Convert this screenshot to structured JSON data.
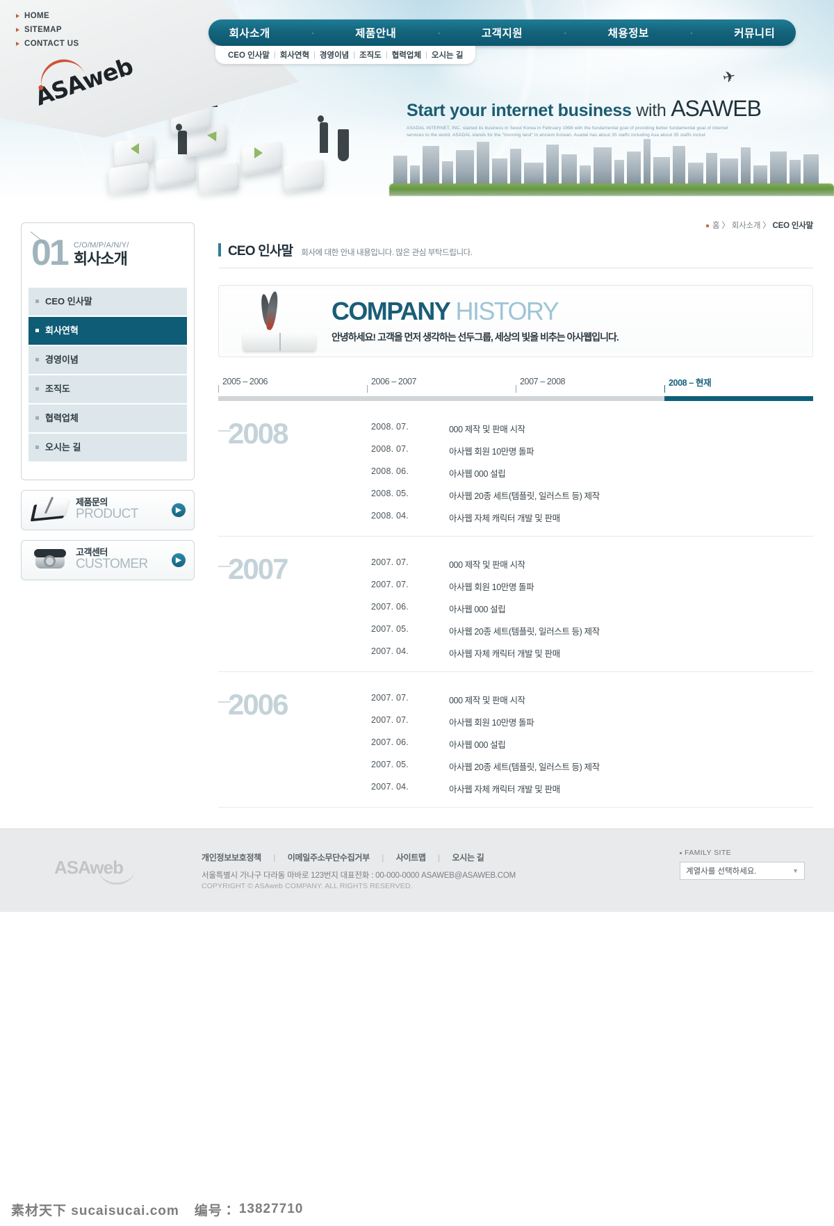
{
  "utility_nav": [
    {
      "label": "HOME"
    },
    {
      "label": "SITEMAP"
    },
    {
      "label": "CONTACT US"
    }
  ],
  "logo": {
    "text": "ASAweb"
  },
  "gnb": {
    "separator": "·",
    "items": [
      {
        "label": "회사소개"
      },
      {
        "label": "제품안내"
      },
      {
        "label": "고객지원"
      },
      {
        "label": "채용정보"
      },
      {
        "label": "커뮤니티"
      }
    ]
  },
  "snb": {
    "separator": "|",
    "items": [
      {
        "label": "CEO 인사말"
      },
      {
        "label": "회사연혁"
      },
      {
        "label": "경영이념"
      },
      {
        "label": "조직도"
      },
      {
        "label": "협력업체"
      },
      {
        "label": "오시는 길"
      }
    ]
  },
  "hero": {
    "headline_1": "Start your internet business",
    "headline_2": "with",
    "headline_brand": "ASAWEB",
    "subtext": "ASADAL INTERNET, INC. started its business in Seoul Korea in February 1998 with the fundamental goal of providing better fundamental goal of internet services to the world. ASADAL stands for the \"morning land\" in ancient Korean. Asadal has about 35 staffs including Asa about 35 staffs includ"
  },
  "sidebar": {
    "number": "01",
    "eng_title": "C/O/M/P/A/N/Y/",
    "kor_title": "회사소개",
    "menu": [
      {
        "label": "CEO 인사말",
        "active": false
      },
      {
        "label": "회사연혁",
        "active": true
      },
      {
        "label": "경영이념",
        "active": false
      },
      {
        "label": "조직도",
        "active": false
      },
      {
        "label": "협력업체",
        "active": false
      },
      {
        "label": "오시는 길",
        "active": false
      }
    ],
    "banners": [
      {
        "kor": "제품문의",
        "eng": "PRODUCT",
        "icon": "notebook-icon",
        "arrow": "▶"
      },
      {
        "kor": "고객센터",
        "eng": "CUSTOMER",
        "icon": "telephone-icon",
        "arrow": "▶"
      }
    ]
  },
  "breadcrumb": {
    "items": [
      "홈",
      "회사소개",
      "CEO 인사말"
    ],
    "separator": "〉"
  },
  "page_title": {
    "title": "CEO 인사말",
    "description": "회사에 대한 안내 내용입니다. 많은 관심 부탁드립니다."
  },
  "history_banner": {
    "heading_bold": "COMPANY",
    "heading_light": "HISTORY",
    "subtitle": "안녕하세요! 고객을 먼저 생각하는 선두그룹, 세상의 빛을 비추는 아사웹입니다."
  },
  "tabs": [
    {
      "label": "2005 – 2006",
      "active": false
    },
    {
      "label": "2006 – 2007",
      "active": false
    },
    {
      "label": "2007 – 2008",
      "active": false
    },
    {
      "label": "2008 – 현재",
      "active": true
    }
  ],
  "history_groups": [
    {
      "year": "2008",
      "rows": [
        {
          "date": "2008. 07.",
          "text": "000  제작 및 판매 시작"
        },
        {
          "date": "2008. 07.",
          "text": "아사웹 회원 10만명 돌파"
        },
        {
          "date": "2008. 06.",
          "text": "아사웹 000 설립"
        },
        {
          "date": "2008. 05.",
          "text": "아사웹 20종 세트(템플릿, 일러스트 등) 제작"
        },
        {
          "date": "2008. 04.",
          "text": "아사웹 자체 캐릭터 개발 및 판매"
        }
      ]
    },
    {
      "year": "2007",
      "rows": [
        {
          "date": "2007. 07.",
          "text": "000  제작 및 판매 시작"
        },
        {
          "date": "2007. 07.",
          "text": "아사웹 회원 10만명 돌파"
        },
        {
          "date": "2007. 06.",
          "text": "아사웹 000 설립"
        },
        {
          "date": "2007. 05.",
          "text": "아사웹 20종 세트(템플릿, 일러스트 등) 제작"
        },
        {
          "date": "2007. 04.",
          "text": "아사웹 자체 캐릭터 개발 및 판매"
        }
      ]
    },
    {
      "year": "2006",
      "rows": [
        {
          "date": "2007. 07.",
          "text": "000  제작 및 판매 시작"
        },
        {
          "date": "2007. 07.",
          "text": "아사웹 회원 10만명 돌파"
        },
        {
          "date": "2007. 06.",
          "text": "아사웹 000 설립"
        },
        {
          "date": "2007. 05.",
          "text": "아사웹 20종 세트(템플릿, 일러스트 등) 제작"
        },
        {
          "date": "2007. 04.",
          "text": "아사웹 자체 캐릭터 개발 및 판매"
        }
      ]
    }
  ],
  "footer": {
    "logo": "ASAweb",
    "links": [
      {
        "label": "개인정보보호정책"
      },
      {
        "label": "이메일주소무단수집거부"
      },
      {
        "label": "사이트맵"
      },
      {
        "label": "오시는 길"
      }
    ],
    "link_separator": "|",
    "address": "서울특별시 가나구 다라동 마바로 123번지   대표전화 : 00-000-0000  ASAWEB@ASAWEB.COM",
    "copyright": "COPYRIGHT © ASAweb COMPANY. ALL RIGHTS RESERVED.",
    "family_site": {
      "label": "FAMILY SITE",
      "selected": "계열사를 선택하세요.",
      "options": [
        "계열사를 선택하세요."
      ]
    }
  },
  "watermark": {
    "site": "素材天下 sucaisucai.com",
    "id_label": "编号：",
    "id_value": "13827710"
  },
  "colors": {
    "brand_teal": "#0e5c76",
    "accent_orange": "#cf5336",
    "sidebar_item": "#dde7eb",
    "footer_bg": "#e9eaeb"
  }
}
